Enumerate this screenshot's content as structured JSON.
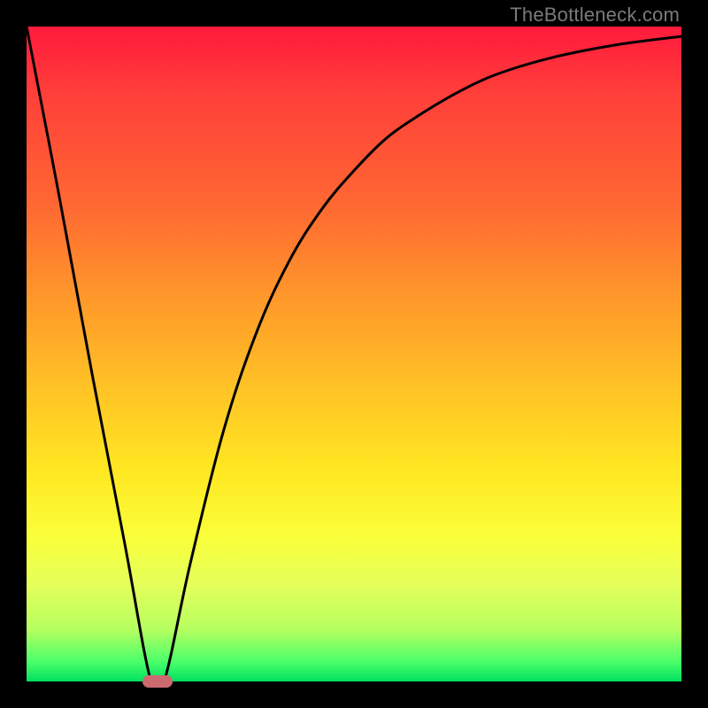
{
  "watermark": "TheBottleneck.com",
  "chart_data": {
    "type": "line",
    "title": "",
    "xlabel": "",
    "ylabel": "",
    "xlim": [
      0,
      100
    ],
    "ylim": [
      0,
      100
    ],
    "grid": false,
    "legend": false,
    "background_gradient": {
      "top_color": "#ff1a3c",
      "bottom_color": "#00e060",
      "stops": [
        "red",
        "orange",
        "yellow",
        "green"
      ]
    },
    "series": [
      {
        "name": "bottleneck-curve",
        "color": "#000000",
        "x": [
          0,
          5,
          10,
          15,
          19,
          21,
          25,
          30,
          35,
          40,
          45,
          50,
          55,
          60,
          65,
          70,
          75,
          80,
          85,
          90,
          95,
          100
        ],
        "y": [
          100,
          74,
          47,
          21,
          0,
          0,
          18,
          38,
          53,
          64,
          72,
          78,
          83,
          86.5,
          89.5,
          92,
          93.8,
          95.2,
          96.3,
          97.2,
          97.9,
          98.5
        ]
      }
    ],
    "marker": {
      "name": "bottleneck-indicator",
      "x": 20,
      "y": 0,
      "color": "#cc6a6f",
      "shape": "pill"
    }
  }
}
